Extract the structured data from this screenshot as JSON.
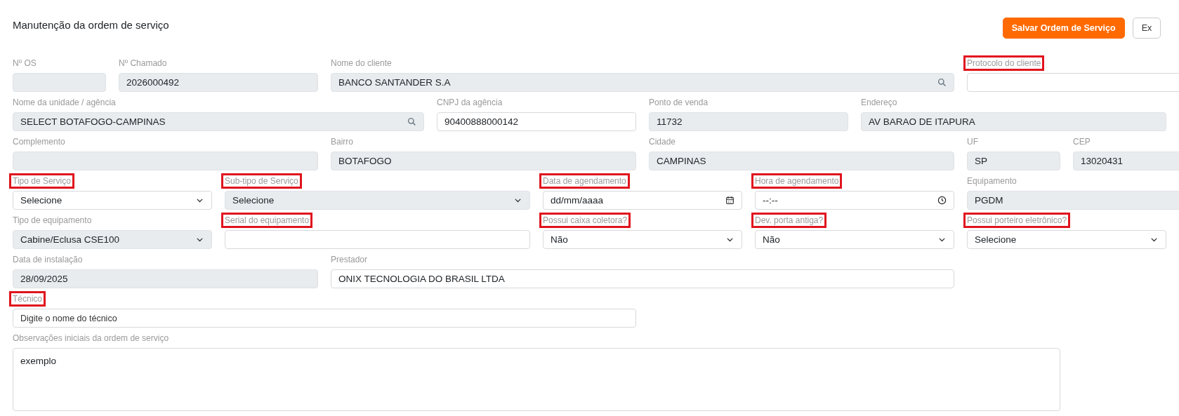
{
  "title": "Manutenção da ordem de serviço",
  "actions": [
    {
      "label": "Salvar Ordem de Serviço",
      "kind": "primary"
    },
    {
      "label": "Ex",
      "kind": "outline"
    }
  ],
  "rows": [
    {
      "fields": [
        {
          "label": "Nº OS",
          "kind": "text",
          "disabled": true,
          "highlighted": false
        },
        {
          "label": "Nº Chamado",
          "kind": "text",
          "value": "2026000492",
          "disabled": true,
          "highlighted": false
        },
        {
          "label": "Nome do cliente",
          "kind": "search",
          "value": "BANCO SANTANDER S.A",
          "disabled": true,
          "highlighted": false
        },
        {
          "label": "Protocolo do cliente",
          "kind": "text",
          "disabled": false,
          "highlighted": true
        }
      ]
    },
    {
      "fields": [
        {
          "label": "Nome da unidade / agência",
          "kind": "search",
          "value": "SELECT BOTAFOGO-CAMPINAS",
          "disabled": true,
          "highlighted": false
        },
        {
          "label": "CNPJ da agência",
          "kind": "text",
          "value": "90400888000142",
          "disabled": false,
          "highlighted": false
        },
        {
          "label": "Ponto de venda",
          "kind": "text",
          "value": "11732",
          "disabled": true,
          "highlighted": false
        },
        {
          "label": "Endereço",
          "kind": "text",
          "value": "AV BARAO DE ITAPURA",
          "disabled": true,
          "highlighted": false
        }
      ]
    },
    {
      "fields": [
        {
          "label": "Complemento",
          "kind": "text",
          "disabled": true,
          "highlighted": false
        },
        {
          "label": "Bairro",
          "kind": "text",
          "value": "BOTAFOGO",
          "disabled": true,
          "highlighted": false
        },
        {
          "label": "Cidade",
          "kind": "text",
          "value": "CAMPINAS",
          "disabled": true,
          "highlighted": false
        },
        {
          "label": "UF",
          "kind": "text",
          "value": "SP",
          "disabled": true,
          "highlighted": false
        },
        {
          "label": "CEP",
          "kind": "text",
          "value": "13020431",
          "disabled": true,
          "highlighted": false
        }
      ]
    },
    {
      "fields": [
        {
          "label": "Tipo de Serviço",
          "kind": "select",
          "value": "Selecione",
          "disabled": false,
          "highlighted": true
        },
        {
          "label": "Sub-tipo de Serviço",
          "kind": "select",
          "value": "Selecione",
          "disabled": true,
          "highlighted": true
        },
        {
          "label": "Data de agendamento",
          "kind": "date",
          "value": "dd/mm/aaaa",
          "disabled": false,
          "highlighted": true
        },
        {
          "label": "Hora de agendamento",
          "kind": "time",
          "value": "--:--",
          "disabled": false,
          "highlighted": true
        },
        {
          "label": "Equipamento",
          "kind": "text",
          "value": "PGDM",
          "disabled": true,
          "highlighted": false
        }
      ]
    },
    {
      "fields": [
        {
          "label": "Tipo de equipamento",
          "kind": "select",
          "value": "Cabine/Eclusa CSE100",
          "disabled": true,
          "highlighted": false
        },
        {
          "label": "Serial do equipamento",
          "kind": "text",
          "disabled": false,
          "highlighted": true
        },
        {
          "label": "Possui caixa coletora?",
          "kind": "select",
          "value": "Não",
          "disabled": false,
          "highlighted": true
        },
        {
          "label": "Dev. porta antiga?",
          "kind": "select",
          "value": "Não",
          "disabled": false,
          "highlighted": true
        },
        {
          "label": "Possui porteiro eletrônico?",
          "kind": "select",
          "value": "Selecione",
          "disabled": false,
          "highlighted": true
        }
      ]
    },
    {
      "fields": [
        {
          "label": "Data de instalação",
          "kind": "text",
          "value": "28/09/2025",
          "disabled": true,
          "highlighted": false
        },
        {
          "label": "Prestador",
          "kind": "text",
          "value": "ONIX TECNOLOGIA DO BRASIL LTDA",
          "disabled": false,
          "highlighted": false
        }
      ]
    },
    {
      "fields": [
        {
          "label": "Técnico",
          "kind": "text",
          "placeholder": "Digite o nome do técnico",
          "disabled": false,
          "highlighted": true
        }
      ]
    },
    {
      "fields": [
        {
          "label": "Observações iniciais da ordem de serviço",
          "kind": "textarea",
          "value": "exemplo",
          "disabled": false,
          "highlighted": false
        }
      ]
    }
  ]
}
